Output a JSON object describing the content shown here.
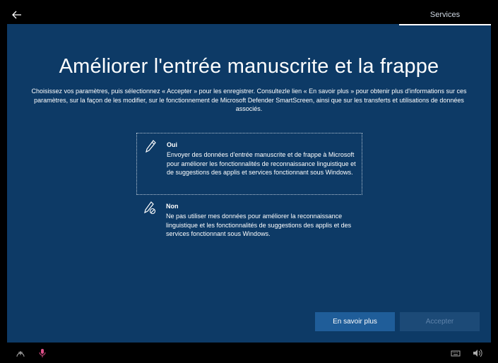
{
  "header": {
    "tab_label": "Services"
  },
  "page": {
    "title": "Améliorer l'entrée manuscrite et la frappe",
    "description": "Choisissez vos paramètres, puis sélectionnez « Accepter » pour les enregistrer. Consultezle lien « En savoir plus » pour obtenir plus d'informations sur ces paramètres, sur la façon de les modifier, sur le fonctionnement de Microsoft Defender SmartScreen, ainsi que sur les transferts et utilisations de données associés."
  },
  "options": [
    {
      "title": "Oui",
      "text": "Envoyer des données d'entrée manuscrite et de frappe à Microsoft pour améliorer les fonctionnalités de reconnaissance linguistique et de suggestions des applis et services fonctionnant sous Windows.",
      "selected": true,
      "icon": "pen-icon"
    },
    {
      "title": "Non",
      "text": "Ne pas utiliser mes données pour améliorer la reconnaissance linguistique et les fonctionnalités de suggestions des applis et des services fonctionnant sous Windows.",
      "selected": false,
      "icon": "pen-disabled-icon"
    }
  ],
  "buttons": {
    "learn_more": "En savoir plus",
    "accept": "Accepter"
  },
  "colors": {
    "background": "#0d3a66",
    "button": "#1f5d99",
    "button_disabled": "#1c4a77",
    "taskbar_mic": "#e0508a"
  }
}
